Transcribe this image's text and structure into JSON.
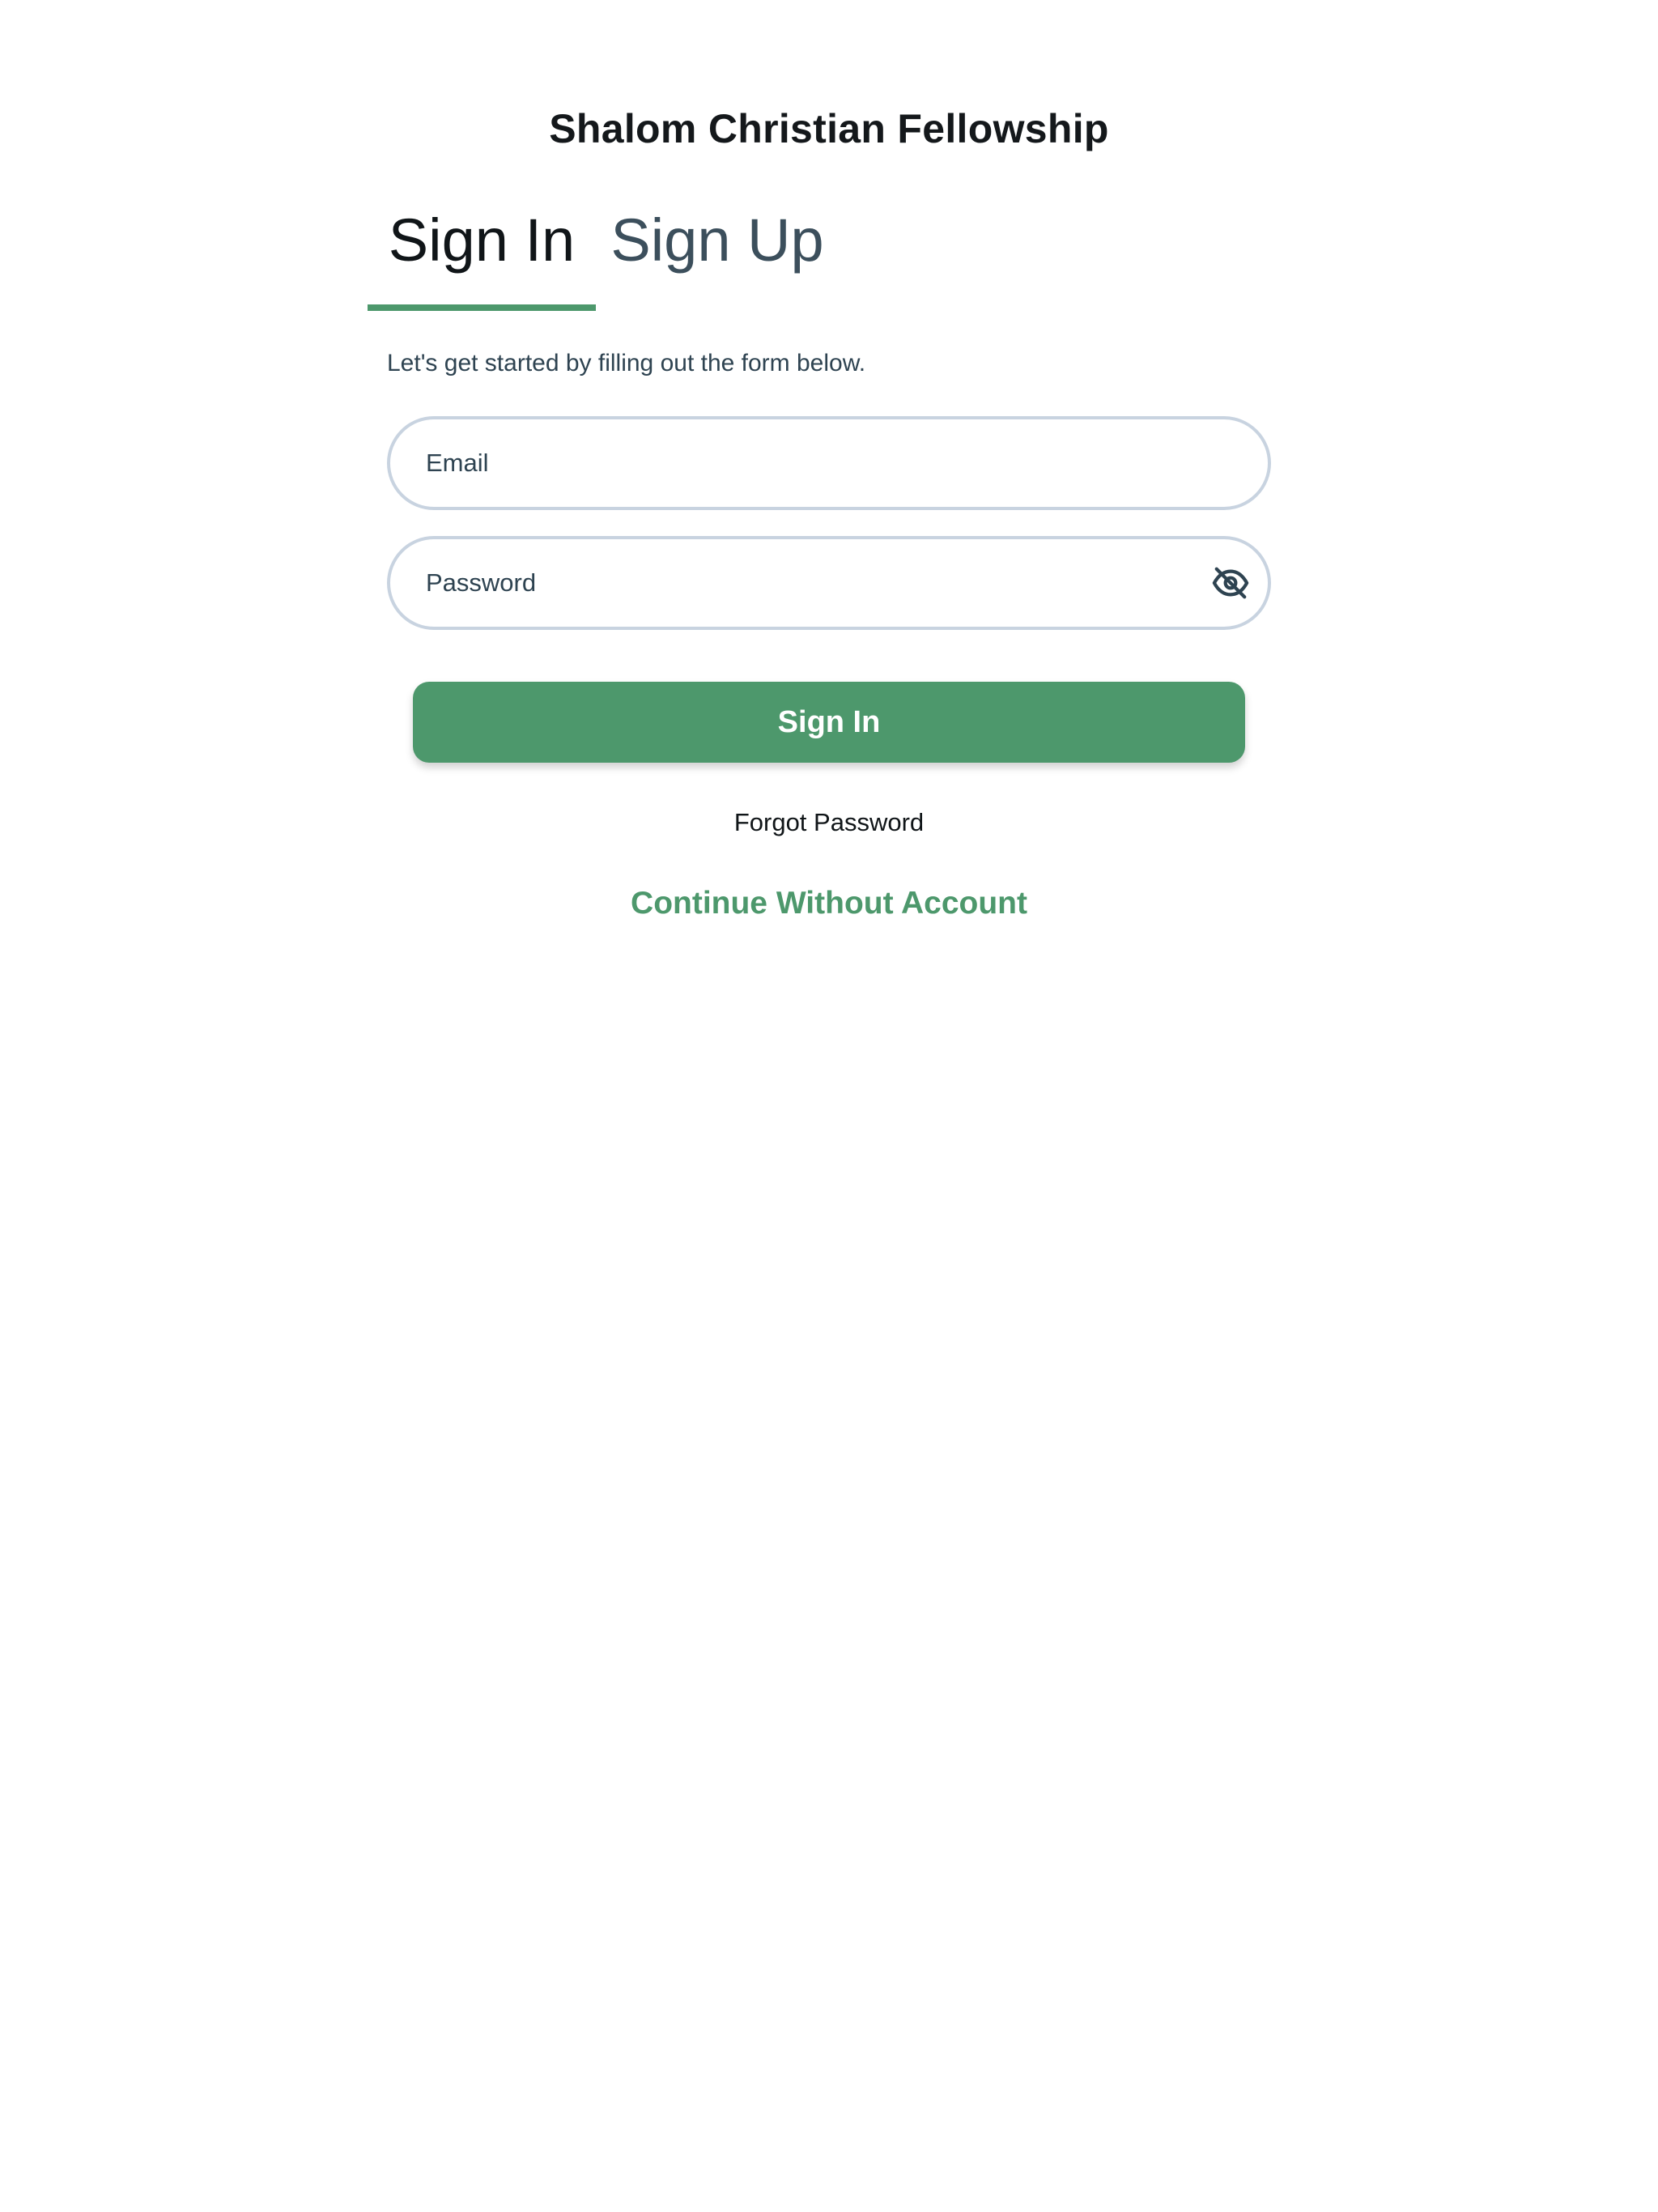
{
  "app": {
    "title": "Shalom Christian Fellowship"
  },
  "tabs": [
    {
      "label": "Sign In",
      "active": true
    },
    {
      "label": "Sign Up",
      "active": false
    }
  ],
  "form": {
    "subtitle": "Let's get started by filling out the form below.",
    "email": {
      "value": "",
      "placeholder": "Email"
    },
    "password": {
      "value": "",
      "placeholder": "Password",
      "toggle_icon": "eye-off-icon"
    },
    "submit_label": "Sign In"
  },
  "links": {
    "forgot_password": "Forgot Password",
    "continue_without_account": "Continue Without Account"
  },
  "colors": {
    "accent": "#4d986c",
    "input_border": "#c8d3e0",
    "primary_text": "#14181b",
    "secondary_text": "#2e4351",
    "inactive_tab": "#3c4f5c",
    "background": "#ffffff"
  }
}
